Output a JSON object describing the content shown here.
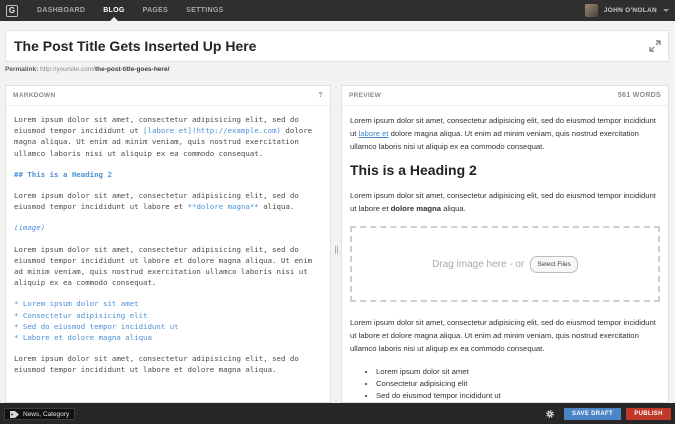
{
  "nav": {
    "logo": "G",
    "items": [
      "DASHBOARD",
      "BLOG",
      "PAGES",
      "SETTINGS"
    ],
    "active": "BLOG",
    "user_name": "JOHN O'NOLAN"
  },
  "post": {
    "title": "The Post Title Gets Inserted Up Here",
    "permalink_label": "Permalink:",
    "permalink_base": "http://yoursite.com/",
    "permalink_slug": "the-post-title-goes-here/"
  },
  "markdown": {
    "label": "MARKDOWN",
    "help": "?",
    "p1_a": "Lorem ipsum dolor sit amet, consectetur adipisicing elit, sed do eiusmod tempor incididunt ut ",
    "p1_link": "[labore et](http://example.com)",
    "p1_b": " dolore magna aliqua. Ut enim ad minim veniam, quis nostrud exercitation ullamco laboris nisi ut aliquip ex ea commodo consequat.",
    "h2": "## This is a Heading 2",
    "p2_a": "Lorem ipsum dolor sit amet, consectetur adipisicing elit, sed do eiusmod tempor incididunt ut labore et ",
    "p2_bold": "**dolore magna**",
    "p2_b": " aliqua.",
    "image": "(image)",
    "p3": "Lorem ipsum dolor sit amet, consectetur adipisicing elit, sed do eiusmod tempor incididunt ut labore et dolore magna aliqua. Ut enim ad minim veniam, quis nostrud exercitation ullamco laboris nisi ut aliquip ex ea commodo consequat.",
    "list": [
      "* Lorem ipsum dolor sit amet",
      "* Consectetur adipisicing elit",
      "* Sed do eiusmod tempor incididunt ut",
      "* Labore et dolore magna aliqua"
    ],
    "p4": "Lorem ipsum dolor sit amet, consectetur adipisicing elit, sed do eiusmod tempor incididunt ut labore et dolore magna aliqua."
  },
  "preview": {
    "label": "PREVIEW",
    "word_count": "561 WORDS",
    "p1_a": "Lorem ipsum dolor sit amet, consectetur adipisicing elit, sed do eiusmod tempor incididunt ut ",
    "p1_link": "labore et",
    "p1_b": " dolore magna aliqua. Ut enim ad minim veniam, quis nostrud exercitation ullamco laboris nisi ut aliquip ex ea commodo consequat.",
    "h2": "This is a Heading 2",
    "p2_a": "Lorem ipsum dolor sit amet, consectetur adipisicing elit, sed do eiusmod tempor incididunt ut labore et ",
    "p2_bold": "dolore magna",
    "p2_b": " aliqua.",
    "drop_text": "Drag image here - or",
    "select_files": "Select Files",
    "p3": "Lorem ipsum dolor sit amet, consectetur adipisicing elit, sed do eiusmod tempor incididunt ut labore et dolore magna aliqua. Ut enim ad minim veniam, quis nostrud exercitation ullamco laboris nisi ut aliquip ex ea commodo consequat.",
    "list": [
      "Lorem ipsum dolor sit amet",
      "Consectetur adipisicing elit",
      "Sed do eiusmod tempor incididunt ut"
    ]
  },
  "footer": {
    "tags": "News, Category",
    "save_draft": "SAVE DRAFT",
    "publish": "PUBLISH"
  },
  "colors": {
    "topbar": "#2f2f2f",
    "markdown_accent": "#4a90d9",
    "save_draft": "#4b84c7",
    "publish": "#c0392b"
  },
  "icons": [
    "logo-icon",
    "expand-icon",
    "tag-icon",
    "gear-icon"
  ]
}
